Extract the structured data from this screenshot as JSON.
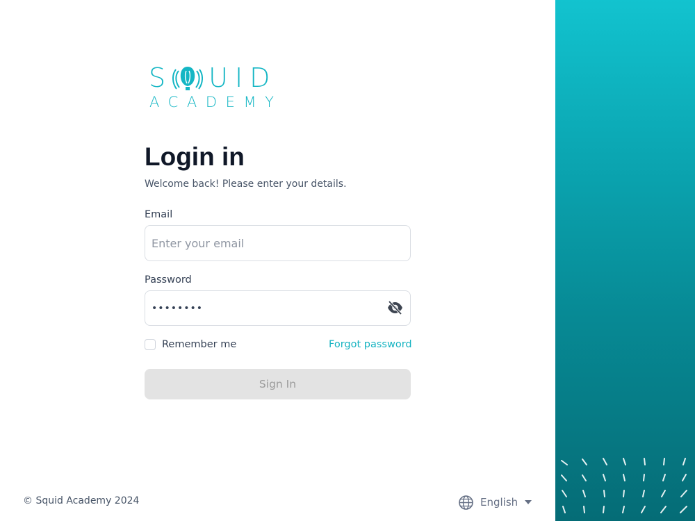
{
  "brand": {
    "logo_top_left": "S",
    "logo_top_right": "UID",
    "logo_bottom": "ACADEMY",
    "color": "#14b6c4"
  },
  "login": {
    "title": "Login in",
    "subtitle": "Welcome back! Please enter your details.",
    "email_label": "Email",
    "email_placeholder": "Enter your email",
    "email_value": "",
    "password_label": "Password",
    "password_value": "••••••••",
    "password_toggle_icon": "eye-off-icon",
    "remember_label": "Remember me",
    "remember_checked": false,
    "forgot_label": "Forgot password",
    "signin_label": "Sign In",
    "accent": "#16b3c1",
    "signin_bg": "#e3e3e3"
  },
  "footer": {
    "copyright": "© Squid Academy 2024",
    "language": "English",
    "language_icon": "globe-icon",
    "language_caret_icon": "caret-down-icon"
  },
  "side_panel": {
    "gradient_top": "#12c3cf",
    "gradient_bottom": "#056c76"
  }
}
